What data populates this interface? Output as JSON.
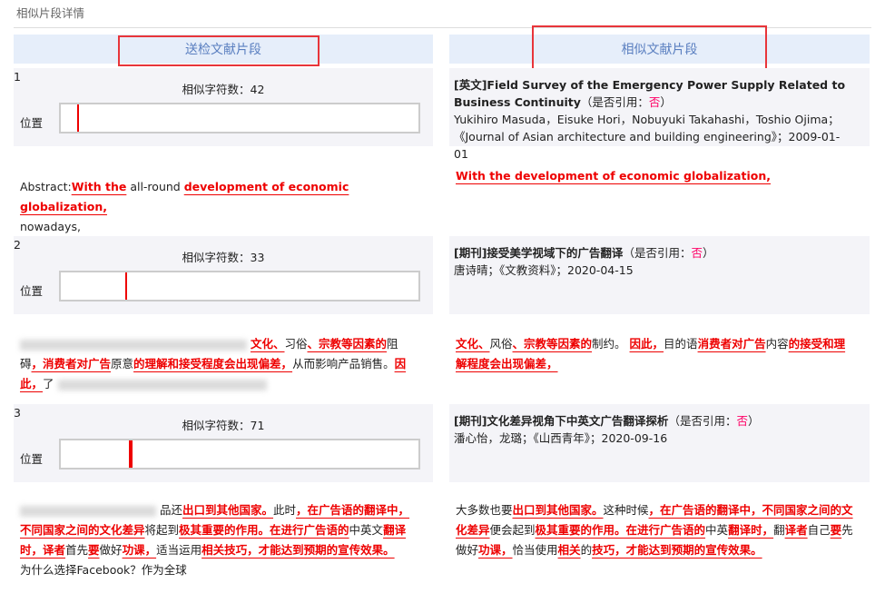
{
  "title": "相似片段详情",
  "left_header": "送检文献片段",
  "right_header": "相似文献片段",
  "position_label": "位置",
  "count_prefix": "相似字符数：",
  "cite_prefix": "（是否引用：",
  "cite_suffix": "）",
  "highlight_color": "#e00000",
  "fragments": [
    {
      "index": "1",
      "count": "42",
      "position_percent": 4.5,
      "left_text": [
        {
          "t": "Abstract:",
          "h": false
        },
        {
          "t": "With the",
          "h": true
        },
        {
          "t": " all-round ",
          "h": false
        },
        {
          "t": "development of economic globalization,",
          "h": true
        }
      ],
      "left_tail": "nowadays,",
      "source": {
        "title": "[英文]Field Survey of the Emergency Power Supply Related to Business Continuity",
        "cite": "否",
        "meta": "Yukihiro Masuda，Eisuke Hori，Nobuyuki Takahashi，Toshio Ojima；《Journal of Asian architecture and building engineering》；2009-01-01"
      },
      "right_text": [
        {
          "t": "With the development of economic globalization,",
          "h": true
        }
      ]
    },
    {
      "index": "2",
      "count": "33",
      "position_percent": 18,
      "left_text": [
        {
          "t": "文化、",
          "h": true
        },
        {
          "t": "习俗",
          "h": false
        },
        {
          "t": "、宗教等因素的",
          "h": true
        },
        {
          "t": "阻碍",
          "h": false
        },
        {
          "t": "，消费者对广告",
          "h": true
        },
        {
          "t": "原意",
          "h": false
        },
        {
          "t": "的理解和接受程度会出现偏差，",
          "h": true
        },
        {
          "t": "从而影响产品销售。",
          "h": false
        },
        {
          "t": "因此，",
          "h": true
        },
        {
          "t": "了",
          "h": false
        }
      ],
      "left_tail": "",
      "source": {
        "title": "[期刊]接受美学视域下的广告翻译",
        "cite": "否",
        "meta": "唐诗晴；《文教资料》；2020-04-15"
      },
      "right_text": [
        {
          "t": "文化、",
          "h": true
        },
        {
          "t": "风俗",
          "h": false
        },
        {
          "t": "、宗教等因素的",
          "h": true
        },
        {
          "t": "制约。 ",
          "h": false
        },
        {
          "t": "因此，",
          "h": true
        },
        {
          "t": "目的语",
          "h": false
        },
        {
          "t": "消费者对广告",
          "h": true
        },
        {
          "t": "内容",
          "h": false
        },
        {
          "t": "的接受和理解程度会出现偏差，",
          "h": true
        }
      ]
    },
    {
      "index": "3",
      "count": "71",
      "position_percent": 19,
      "left_text": [
        {
          "t": "品还",
          "h": false
        },
        {
          "t": "出口到其他国家。",
          "h": true
        },
        {
          "t": "此时",
          "h": false
        },
        {
          "t": "，在广告语的翻译中，不同国家之间的文化差异",
          "h": true
        },
        {
          "t": "将起到",
          "h": false
        },
        {
          "t": "极其重要的作用。在进行广告语的",
          "h": true
        },
        {
          "t": "中英文",
          "h": false
        },
        {
          "t": "翻译时，译者",
          "h": true
        },
        {
          "t": "首先",
          "h": false
        },
        {
          "t": "要",
          "h": true
        },
        {
          "t": "做好",
          "h": false
        },
        {
          "t": "功课，",
          "h": true
        },
        {
          "t": "适当运用",
          "h": false
        },
        {
          "t": "相关技巧，才能达到预期的宣传效果。",
          "h": true
        }
      ],
      "left_tail": "为什么选择Facebook？作为全球",
      "source": {
        "title": "[期刊]文化差异视角下中英文广告翻译探析",
        "cite": "否",
        "meta": "潘心怡，龙璐；《山西青年》；2020-09-16"
      },
      "right_text": [
        {
          "t": "大多数也要",
          "h": false
        },
        {
          "t": "出口到其他国家。",
          "h": true
        },
        {
          "t": "这种时候",
          "h": false
        },
        {
          "t": "，在广告语的翻译中，不同国家之间的文化差异",
          "h": true
        },
        {
          "t": "便会起到",
          "h": false
        },
        {
          "t": "极其重要的作用。在进行广告语的",
          "h": true
        },
        {
          "t": "中英",
          "h": false
        },
        {
          "t": "翻译时，",
          "h": true
        },
        {
          "t": "翻",
          "h": false
        },
        {
          "t": "译者",
          "h": true
        },
        {
          "t": "自己",
          "h": false
        },
        {
          "t": "要",
          "h": true
        },
        {
          "t": "先做好",
          "h": false
        },
        {
          "t": "功课，",
          "h": true
        },
        {
          "t": "恰当使用",
          "h": false
        },
        {
          "t": "相关",
          "h": true
        },
        {
          "t": "的",
          "h": false
        },
        {
          "t": "技巧，才能达到预期的宣传效果。",
          "h": true
        }
      ]
    }
  ]
}
